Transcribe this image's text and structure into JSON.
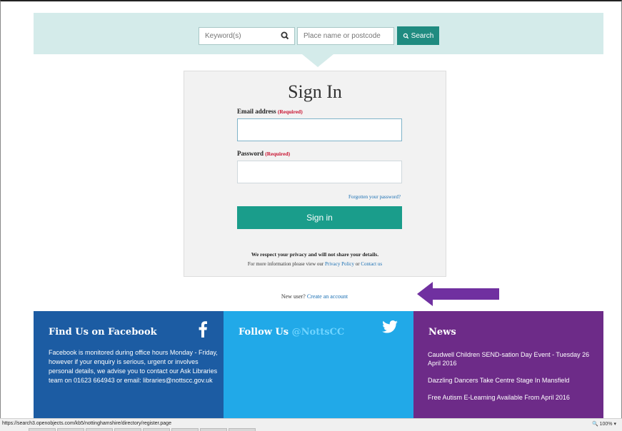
{
  "search": {
    "keyword_placeholder": "Keyword(s)",
    "place_placeholder": "Place name or postcode",
    "button_label": "Search"
  },
  "signin": {
    "title": "Sign In",
    "email_label": "Email address",
    "password_label": "Password",
    "required_tag": "(Required)",
    "forgot_link": "Forgotten your password?",
    "button_label": "Sign in",
    "privacy_bold": "We respect your privacy and will not share your details.",
    "privacy_prefix": "For more information please view our",
    "privacy_link": "Privacy Policy",
    "privacy_or": "or",
    "contact_link": "Contact us"
  },
  "new_user": {
    "prefix": "New user?",
    "link": "Create an account"
  },
  "footer": {
    "facebook": {
      "title": "Find Us on Facebook",
      "body": "Facebook is monitored during office hours Monday - Friday, however if your enquiry is serious, urgent or involves personal details, we advise you to contact our Ask Libraries team on 01623 664943 or email: libraries@nottscc.gov.uk",
      "icon": "facebook-icon"
    },
    "twitter": {
      "title_prefix": "Follow Us",
      "handle": "@NottsCC",
      "icon": "twitter-icon"
    },
    "news": {
      "title": "News",
      "items": [
        "Caudwell Children SEND-sation Day Event - Tuesday 26 April 2016",
        "Dazzling Dancers Take Centre Stage In Mansfield",
        "Free Autism E-Learning Available From April 2016"
      ]
    }
  },
  "status_bar": {
    "url": "https://search3.openobjects.com/kb5/nottinghamshire/directory/register.page",
    "zoom": "100%"
  },
  "colors": {
    "search_band": "#d4ebea",
    "search_button": "#1f8b80",
    "signin_button": "#1a9d8b",
    "facebook_panel": "#1c5ca3",
    "twitter_panel": "#21a9e8",
    "news_panel": "#6d2b88",
    "annotation_arrow": "#7030a0",
    "link": "#1a6fb3",
    "required": "#c8102e"
  }
}
